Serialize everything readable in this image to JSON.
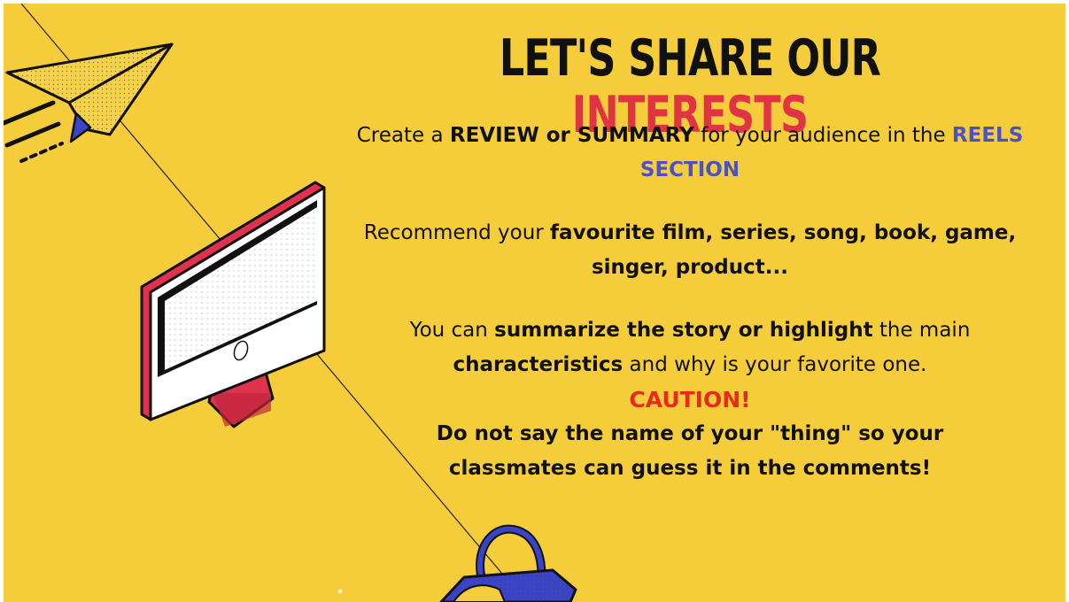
{
  "title": {
    "part1": "LET'S SHARE OUR ",
    "part2": "INTERESTS"
  },
  "paragraph1": {
    "t1": "Create a ",
    "b1": "REVIEW or SUMMARY",
    "t2": " for your audience in the ",
    "b2": "REELS SECTION"
  },
  "paragraph2": {
    "t1": "Recommend your ",
    "b1": "favourite film, series, song, book, game, singer, product..."
  },
  "paragraph3": {
    "t1": "You can ",
    "b1": "summarize the story or highlight",
    "t2": " the main ",
    "b2": "characteristics",
    "t3": " and why is your favorite one."
  },
  "caution": {
    "label": "CAUTION!",
    "line1": "Do not say the name of your \"thing\" so your",
    "line2": "classmates can guess it in the comments!"
  },
  "colors": {
    "background": "#f5cd3b",
    "accent_red": "#e03445",
    "accent_blue": "#4b52c5",
    "caution_red": "#e82a1e"
  },
  "icons": [
    "paper-plane-icon",
    "computer-monitor-icon",
    "shopping-basket-icon"
  ]
}
